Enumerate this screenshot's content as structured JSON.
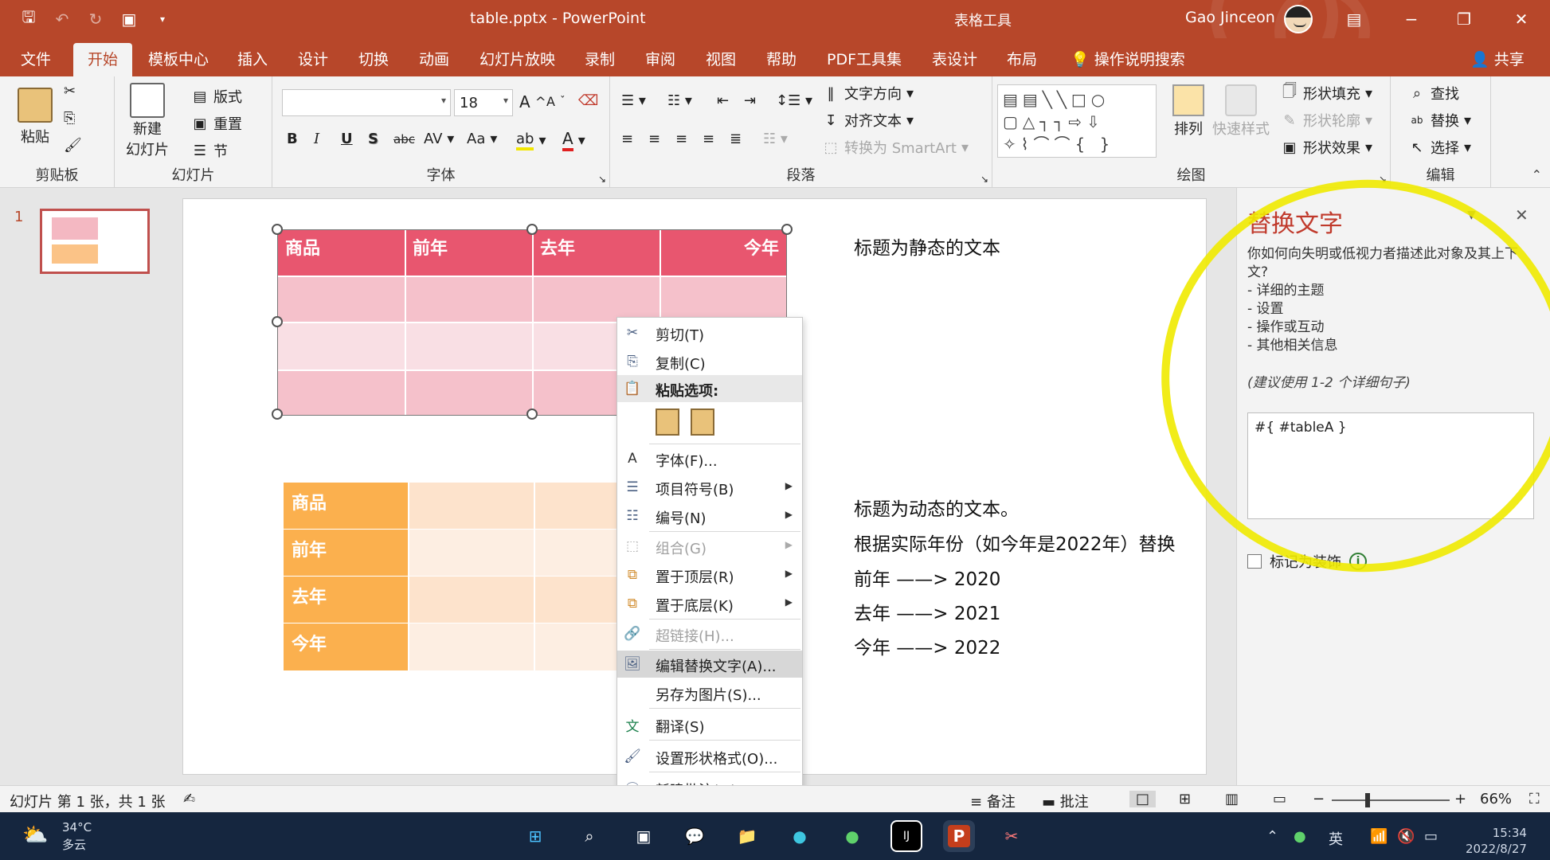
{
  "titlebar": {
    "doc_title": "table.pptx  -  PowerPoint",
    "context_tools": "表格工具",
    "user": "Gao Jinceon"
  },
  "tabs": [
    "文件",
    "开始",
    "模板中心",
    "插入",
    "设计",
    "切换",
    "动画",
    "幻灯片放映",
    "录制",
    "审阅",
    "视图",
    "帮助",
    "PDF工具集",
    "表设计",
    "布局",
    "操作说明搜索"
  ],
  "share_label": "共享",
  "ribbon": {
    "clipboard": {
      "paste": "粘贴",
      "label": "剪贴板"
    },
    "slides": {
      "new_line1": "新建",
      "new_line2": "幻灯片",
      "layout": "版式",
      "reset": "重置",
      "section": "节",
      "label": "幻灯片"
    },
    "font": {
      "size": "18",
      "label": "字体",
      "bold": "B",
      "italic": "I",
      "underline": "U",
      "shadow": "S",
      "strike": "abc",
      "case": "Aa",
      "grow": "A",
      "shrink": "A"
    },
    "paragraph": {
      "text_dir": "文字方向",
      "align_text": "对齐文本",
      "smartart": "转换为 SmartArt",
      "label": "段落"
    },
    "drawing": {
      "arrange": "排列",
      "quick_styles": "快速样式",
      "fill": "形状填充",
      "outline": "形状轮廓",
      "effects": "形状效果",
      "label": "绘图"
    },
    "editing": {
      "find": "查找",
      "replace": "替换",
      "select": "选择",
      "label": "编辑"
    }
  },
  "thumbnail": {
    "number": "1"
  },
  "tableA": {
    "headers": [
      "商品",
      "前年",
      "去年",
      "今年"
    ]
  },
  "tableB": {
    "rows": [
      "商品",
      "前年",
      "去年",
      "今年"
    ]
  },
  "slide_text": {
    "static_title": "标题为静态的文本",
    "dynamic_title": "标题为动态的文本。",
    "explain": "根据实际年份（如今年是2022年）替换",
    "line1": "前年 ——> 2020",
    "line2": "去年 ——> 2021",
    "line3": "今年 ——> 2022"
  },
  "context_menu": {
    "cut": "剪切(T)",
    "copy": "复制(C)",
    "paste_options": "粘贴选项:",
    "font": "字体(F)...",
    "bullets": "项目符号(B)",
    "numbering": "编号(N)",
    "group": "组合(G)",
    "bring_front": "置于顶层(R)",
    "send_back": "置于底层(K)",
    "hyperlink": "超链接(H)...",
    "edit_alt_text": "编辑替换文字(A)...",
    "save_as_picture": "另存为图片(S)...",
    "translate": "翻译(S)",
    "format_shape": "设置形状格式(O)...",
    "new_comment": "新建批注(M)"
  },
  "alt_text_pane": {
    "title": "替换文字",
    "desc1": "你如何向失明或低视力者描述此对象及其上下文?",
    "bullet1": "- 详细的主题",
    "bullet2": "- 设置",
    "bullet3": "- 操作或互动",
    "bullet4": "- 其他相关信息",
    "hint": "(建议使用 1-2 个详细句子)",
    "value": "#{ #tableA }",
    "decorative_label": "标记为装饰"
  },
  "statusbar": {
    "slide_info": "幻灯片 第 1 张，共 1 张",
    "notes": "备注",
    "comments": "批注",
    "zoom": "66%"
  },
  "taskbar": {
    "temperature": "34°C",
    "weather": "多云",
    "ime": "英",
    "time": "15:34",
    "date": "2022/8/27"
  },
  "colors": {
    "accent": "#b7472a",
    "tableA_header": "#e8566f",
    "tableB_header": "#fbb04e",
    "highlight": "#f0ea00"
  }
}
